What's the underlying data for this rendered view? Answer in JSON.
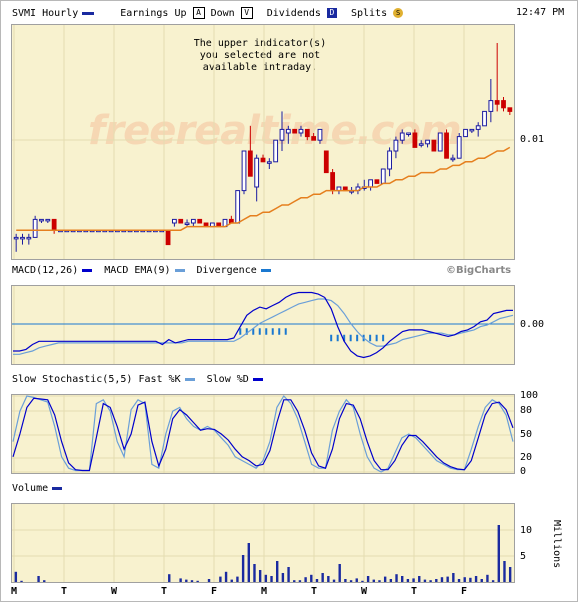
{
  "header": {
    "symbol": "SVMI Hourly",
    "earnings_label": "Earnings Up",
    "earnings_up_glyph": "A",
    "down_label": "Down",
    "earnings_down_glyph": "V",
    "dividends_label": "Dividends",
    "dividends_glyph": "D",
    "splits_label": "Splits",
    "splits_glyph": "S",
    "time": "12:47 PM"
  },
  "message": "The upper indicator(s)\nyou selected are not\navailable intraday.",
  "watermark": "freerealtime.com",
  "brand": "©BigCharts",
  "colors": {
    "panel_bg": "#f8f2cf",
    "up_candle": "#1a1aa0",
    "down_candle": "#cc0000",
    "ma_line": "#e57f1e",
    "primary_line": "#0000cc",
    "secondary_line": "#6a9fd8",
    "volume_bar": "#1a2aa0"
  },
  "chart_data": [
    {
      "type": "candlestick",
      "title": "SVMI Hourly",
      "y_tick_labels": [
        "0.01"
      ],
      "x_tick_labels": [
        "M",
        "T",
        "W",
        "T",
        "F",
        "M",
        "T",
        "W",
        "T",
        "F"
      ],
      "ohlc": [
        [
          0.0066,
          0.0067,
          0.0062,
          0.0066
        ],
        [
          0.0066,
          0.0067,
          0.0064,
          0.0066
        ],
        [
          0.0066,
          0.0067,
          0.0064,
          0.0066
        ],
        [
          0.0066,
          0.0072,
          0.0066,
          0.0071
        ],
        [
          0.0071,
          0.0071,
          0.007,
          0.0071
        ],
        [
          0.0071,
          0.0071,
          0.007,
          0.0071
        ],
        [
          0.0071,
          0.0071,
          0.0067,
          0.0068
        ],
        [
          0.0068,
          0.0068,
          0.0068,
          0.0068
        ],
        [
          0.0068,
          0.0068,
          0.0068,
          0.0068
        ],
        [
          0.0068,
          0.0068,
          0.0068,
          0.0068
        ],
        [
          0.0068,
          0.0068,
          0.0068,
          0.0068
        ],
        [
          0.0068,
          0.0068,
          0.0068,
          0.0068
        ],
        [
          0.0068,
          0.0068,
          0.0068,
          0.0068
        ],
        [
          0.0068,
          0.0068,
          0.0068,
          0.0068
        ],
        [
          0.0068,
          0.0068,
          0.0068,
          0.0068
        ],
        [
          0.0068,
          0.0068,
          0.0068,
          0.0068
        ],
        [
          0.0068,
          0.0068,
          0.0068,
          0.0068
        ],
        [
          0.0068,
          0.0068,
          0.0068,
          0.0068
        ],
        [
          0.0068,
          0.0068,
          0.0068,
          0.0068
        ],
        [
          0.0068,
          0.0068,
          0.0068,
          0.0068
        ],
        [
          0.0068,
          0.0068,
          0.0068,
          0.0068
        ],
        [
          0.0068,
          0.0068,
          0.0068,
          0.0068
        ],
        [
          0.0068,
          0.0068,
          0.0068,
          0.0068
        ],
        [
          0.0068,
          0.0068,
          0.0068,
          0.0068
        ],
        [
          0.0068,
          0.0068,
          0.0064,
          0.0064
        ],
        [
          0.007,
          0.0071,
          0.0069,
          0.0071
        ],
        [
          0.0071,
          0.0071,
          0.007,
          0.007
        ],
        [
          0.007,
          0.0071,
          0.0069,
          0.007
        ],
        [
          0.007,
          0.0071,
          0.0069,
          0.0071
        ],
        [
          0.0071,
          0.0071,
          0.007,
          0.007
        ],
        [
          0.007,
          0.007,
          0.0069,
          0.0069
        ],
        [
          0.0069,
          0.007,
          0.0069,
          0.007
        ],
        [
          0.007,
          0.007,
          0.0069,
          0.0069
        ],
        [
          0.0069,
          0.0071,
          0.0069,
          0.0071
        ],
        [
          0.0071,
          0.0072,
          0.007,
          0.007
        ],
        [
          0.007,
          0.0079,
          0.007,
          0.0079
        ],
        [
          0.0079,
          0.009,
          0.0078,
          0.009
        ],
        [
          0.009,
          0.0097,
          0.0083,
          0.0083
        ],
        [
          0.008,
          0.0089,
          0.0076,
          0.0088
        ],
        [
          0.0088,
          0.0089,
          0.0087,
          0.0087
        ],
        [
          0.0087,
          0.0088,
          0.0085,
          0.0087
        ],
        [
          0.0087,
          0.0093,
          0.0087,
          0.0093
        ],
        [
          0.0093,
          0.0101,
          0.009,
          0.0096
        ],
        [
          0.0095,
          0.0097,
          0.0092,
          0.0096
        ],
        [
          0.0096,
          0.0096,
          0.0095,
          0.0095
        ],
        [
          0.0095,
          0.0097,
          0.0094,
          0.0096
        ],
        [
          0.0096,
          0.0096,
          0.0093,
          0.0094
        ],
        [
          0.0094,
          0.0095,
          0.0093,
          0.0093
        ],
        [
          0.0093,
          0.0096,
          0.0092,
          0.0096
        ],
        [
          0.009,
          0.009,
          0.0084,
          0.0084
        ],
        [
          0.0084,
          0.0085,
          0.0078,
          0.0079
        ],
        [
          0.0079,
          0.008,
          0.0078,
          0.008
        ],
        [
          0.008,
          0.008,
          0.0079,
          0.0079
        ],
        [
          0.0079,
          0.008,
          0.0078,
          0.0079
        ],
        [
          0.0079,
          0.0081,
          0.0078,
          0.008
        ],
        [
          0.008,
          0.0082,
          0.0079,
          0.008
        ],
        [
          0.008,
          0.0082,
          0.0079,
          0.0082
        ],
        [
          0.0082,
          0.0082,
          0.0081,
          0.0081
        ],
        [
          0.0081,
          0.0085,
          0.0081,
          0.0085
        ],
        [
          0.0085,
          0.0091,
          0.0083,
          0.009
        ],
        [
          0.009,
          0.0094,
          0.0088,
          0.0093
        ],
        [
          0.0093,
          0.0096,
          0.0092,
          0.0095
        ],
        [
          0.0095,
          0.0095,
          0.0094,
          0.0095
        ],
        [
          0.0095,
          0.0096,
          0.0091,
          0.0091
        ],
        [
          0.0092,
          0.0093,
          0.0091,
          0.0092
        ],
        [
          0.0092,
          0.0093,
          0.0091,
          0.0093
        ],
        [
          0.0093,
          0.0093,
          0.009,
          0.009
        ],
        [
          0.009,
          0.0095,
          0.009,
          0.0095
        ],
        [
          0.0095,
          0.0096,
          0.0088,
          0.0088
        ],
        [
          0.0088,
          0.0089,
          0.0087,
          0.0088
        ],
        [
          0.0088,
          0.0095,
          0.0088,
          0.0094
        ],
        [
          0.0094,
          0.0096,
          0.0094,
          0.0096
        ],
        [
          0.0096,
          0.0096,
          0.0095,
          0.0096
        ],
        [
          0.0096,
          0.0098,
          0.0094,
          0.0097
        ],
        [
          0.0097,
          0.0101,
          0.0097,
          0.0101
        ],
        [
          0.0101,
          0.011,
          0.0098,
          0.0104
        ],
        [
          0.0104,
          0.012,
          0.0101,
          0.0103
        ],
        [
          0.0104,
          0.0105,
          0.0101,
          0.0102
        ],
        [
          0.0102,
          0.0102,
          0.01,
          0.0101
        ]
      ],
      "ema": [
        0.0068,
        0.0068,
        0.0068,
        0.0068,
        0.0068,
        0.0068,
        0.0068,
        0.0068,
        0.0068,
        0.0068,
        0.0068,
        0.0068,
        0.0068,
        0.0068,
        0.0068,
        0.0068,
        0.0068,
        0.0068,
        0.0068,
        0.0068,
        0.0068,
        0.0068,
        0.0068,
        0.0068,
        0.0068,
        0.0068,
        0.0068,
        0.0069,
        0.0069,
        0.0069,
        0.0069,
        0.0069,
        0.0069,
        0.0069,
        0.007,
        0.007,
        0.0071,
        0.0072,
        0.0072,
        0.0073,
        0.0073,
        0.0074,
        0.0075,
        0.0075,
        0.0076,
        0.0077,
        0.0077,
        0.0078,
        0.0078,
        0.0079,
        0.0079,
        0.0079,
        0.0079,
        0.0079,
        0.0079,
        0.008,
        0.008,
        0.008,
        0.0081,
        0.0081,
        0.0082,
        0.0082,
        0.0083,
        0.0083,
        0.0084,
        0.0084,
        0.0084,
        0.0085,
        0.0085,
        0.0086,
        0.0086,
        0.0087,
        0.0087,
        0.0088,
        0.0088,
        0.0089,
        0.009,
        0.009,
        0.0091
      ]
    },
    {
      "type": "line",
      "title": "MACD(12,26)",
      "y_tick_labels": [
        "0.00"
      ],
      "series": [
        {
          "name": "MACD(12,26)",
          "values": [
            -0.0001,
            -0.0001,
            -9e-05,
            -6e-05,
            -4e-05,
            -4e-05,
            -4e-05,
            -4e-05,
            -4e-05,
            -4e-05,
            -4e-05,
            -4e-05,
            -4e-05,
            -4e-05,
            -4e-05,
            -4e-05,
            -4e-05,
            -4e-05,
            -4e-05,
            -4e-05,
            -4e-05,
            -4e-05,
            -4e-05,
            -6e-05,
            -3e-05,
            -5e-05,
            -4e-05,
            -3e-05,
            -3e-05,
            -3e-05,
            -3e-05,
            -3e-05,
            -3e-05,
            -3e-05,
            -2e-05,
            5e-05,
            0.00012,
            0.00015,
            0.00017,
            0.00016,
            0.00018,
            0.0002,
            0.00023,
            0.00025,
            0.00026,
            0.00026,
            0.00026,
            0.00025,
            0.00023,
            0.00016,
            5e-05,
            -4e-05,
            -0.0001,
            -0.00013,
            -0.00014,
            -0.00013,
            -0.00011,
            -8e-05,
            -4e-05,
            -1e-05,
            2e-05,
            3e-05,
            3e-05,
            3e-05,
            2e-05,
            1e-05,
            0.0,
            -1e-05,
            0.0,
            2e-05,
            3e-05,
            5e-05,
            8e-05,
            9e-05,
            0.00013,
            0.00014,
            0.00015,
            0.00015
          ]
        },
        {
          "name": "MACD EMA(9)",
          "values": [
            -0.00012,
            -0.00012,
            -0.00011,
            -0.0001,
            -8e-05,
            -7e-05,
            -6e-05,
            -5e-05,
            -5e-05,
            -5e-05,
            -5e-05,
            -5e-05,
            -5e-05,
            -5e-05,
            -5e-05,
            -5e-05,
            -5e-05,
            -5e-05,
            -5e-05,
            -5e-05,
            -5e-05,
            -5e-05,
            -5e-05,
            -5e-05,
            -5e-05,
            -5e-05,
            -5e-05,
            -4e-05,
            -4e-05,
            -4e-05,
            -4e-05,
            -4e-05,
            -4e-05,
            -4e-05,
            -4e-05,
            -2e-05,
            1e-05,
            4e-05,
            7e-05,
            9e-05,
            0.00011,
            0.00013,
            0.00015,
            0.00017,
            0.00019,
            0.0002,
            0.00021,
            0.00022,
            0.00022,
            0.00021,
            0.00018,
            0.00013,
            7e-05,
            2e-05,
            -2e-05,
            -5e-05,
            -7e-05,
            -7e-05,
            -6e-05,
            -5e-05,
            -3e-05,
            -2e-05,
            -1e-05,
            0.0,
            1e-05,
            1e-05,
            1e-05,
            0.0,
            0.0,
            1e-05,
            2e-05,
            3e-05,
            5e-05,
            6e-05,
            8e-05,
            0.0001,
            0.00011,
            0.00012
          ]
        },
        {
          "name": "Divergence",
          "values": [
            0,
            0,
            0,
            0,
            0,
            0,
            0,
            0,
            0,
            0,
            0,
            0,
            0,
            0,
            0,
            0,
            0,
            0,
            0,
            0,
            0,
            0,
            0,
            0,
            0,
            0,
            0,
            0,
            0,
            0,
            0,
            0,
            0,
            0,
            0,
            1e-05,
            1e-05,
            1e-05,
            1e-05,
            1e-05,
            1e-05,
            1e-05,
            1e-05,
            0,
            0,
            0,
            0,
            0,
            0,
            -1e-05,
            -1e-05,
            -1e-05,
            -1e-05,
            -1e-05,
            -1e-05,
            -1e-05,
            -1e-05,
            -1e-05,
            0,
            0,
            0,
            0,
            0,
            0,
            0,
            0,
            0,
            0,
            0,
            0,
            0,
            0,
            0,
            0,
            0,
            0,
            0,
            0
          ]
        }
      ]
    },
    {
      "type": "line",
      "title": "Slow Stochastic(5,5)",
      "ylim": [
        0,
        100
      ],
      "y_tick_labels": [
        "100",
        "80",
        "50",
        "20",
        "0"
      ],
      "series": [
        {
          "name": "Fast %K",
          "values": [
            40,
            80,
            100,
            98,
            95,
            92,
            60,
            20,
            5,
            2,
            2,
            2,
            90,
            95,
            80,
            40,
            20,
            82,
            95,
            90,
            10,
            5,
            50,
            80,
            85,
            70,
            60,
            55,
            60,
            55,
            45,
            35,
            20,
            15,
            10,
            5,
            15,
            40,
            85,
            100,
            90,
            70,
            40,
            10,
            5,
            5,
            55,
            80,
            95,
            85,
            50,
            20,
            5,
            0,
            5,
            25,
            45,
            50,
            45,
            35,
            25,
            15,
            10,
            5,
            3,
            3,
            30,
            60,
            85,
            95,
            90,
            75,
            40
          ]
        },
        {
          "name": "Slow %D",
          "values": [
            20,
            50,
            85,
            97,
            96,
            95,
            75,
            40,
            12,
            3,
            2,
            2,
            45,
            90,
            85,
            60,
            30,
            50,
            88,
            92,
            40,
            8,
            30,
            70,
            82,
            75,
            65,
            55,
            57,
            56,
            50,
            42,
            30,
            20,
            15,
            8,
            10,
            28,
            65,
            95,
            95,
            80,
            55,
            25,
            8,
            5,
            30,
            70,
            90,
            88,
            70,
            40,
            15,
            3,
            3,
            15,
            35,
            48,
            48,
            40,
            30,
            20,
            12,
            7,
            4,
            3,
            15,
            45,
            75,
            90,
            92,
            82,
            58
          ]
        }
      ]
    },
    {
      "type": "bar",
      "title": "Volume",
      "ylabel": "Millions",
      "y_tick_labels": [
        "10",
        "5"
      ],
      "values": [
        1.7,
        0.2,
        0,
        0,
        1.0,
        0.3,
        0,
        0,
        0,
        0,
        0,
        0,
        0,
        0,
        0,
        0,
        0,
        0,
        0,
        0,
        0,
        0,
        0,
        0,
        0,
        0,
        0,
        1.3,
        0,
        0.6,
        0.4,
        0.3,
        0.2,
        0,
        0.5,
        0,
        0.9,
        1.7,
        0.4,
        0.9,
        4.5,
        6.5,
        3.0,
        2.0,
        1.2,
        1.0,
        3.5,
        1.5,
        2.5,
        0.3,
        0.3,
        0.8,
        1.2,
        0.5,
        1.5,
        1.0,
        0.4,
        3.0,
        0.5,
        0.3,
        0.6,
        0.2,
        1.0,
        0.4,
        0.3,
        0.9,
        0.5,
        1.3,
        1.0,
        0.5,
        0.6,
        1.0,
        0.4,
        0.3,
        0.5,
        0.8,
        0.9,
        1.5,
        0.5,
        0.8,
        0.7,
        1.0,
        0.5,
        1.2,
        0.3,
        9.5,
        3.5,
        2.5
      ]
    }
  ]
}
